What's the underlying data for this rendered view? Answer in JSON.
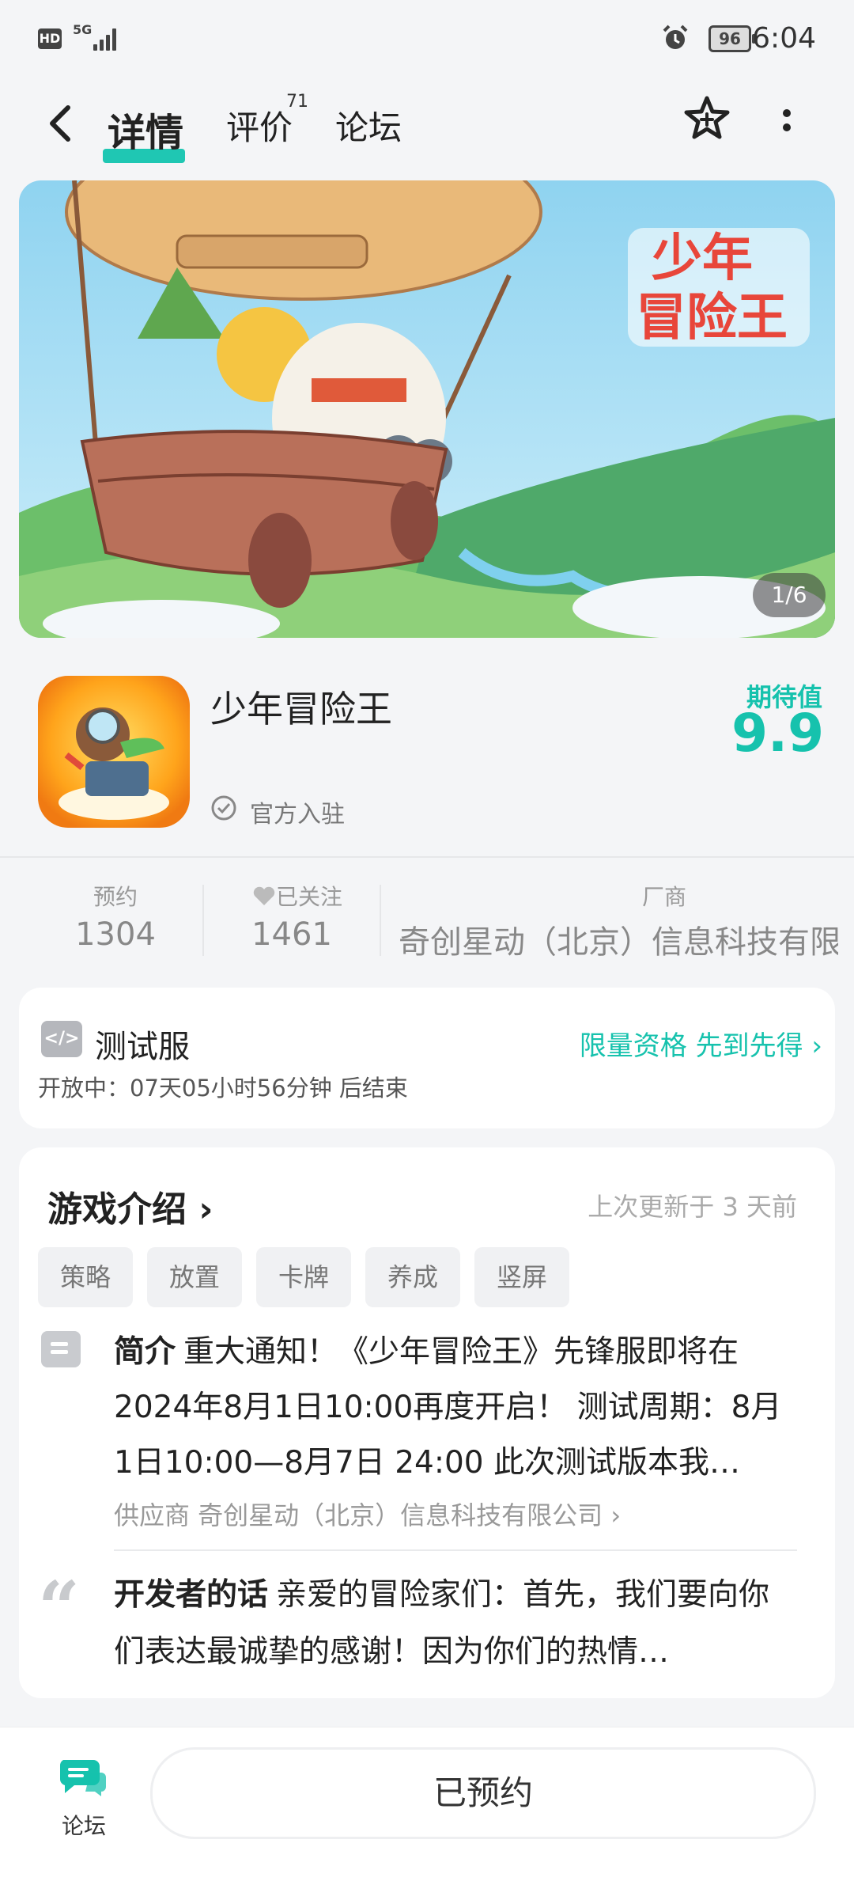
{
  "status_bar": {
    "hd": "HD",
    "network": "5G",
    "battery": "96",
    "time": "6:04"
  },
  "nav": {
    "tab_detail": "详情",
    "tab_review": "评价",
    "review_count": "71",
    "tab_forum": "论坛"
  },
  "banner": {
    "pager": "1/6"
  },
  "app": {
    "name": "少年冒险王",
    "official": "官方入驻",
    "expect_label": "期待值",
    "expect_score": "9.9"
  },
  "stats": [
    {
      "label": "预约",
      "value": "1304"
    },
    {
      "label": "已关注",
      "value": "1461"
    },
    {
      "label": "厂商",
      "value": "奇创星动（北京）信息科技有限"
    }
  ],
  "test": {
    "title": "测试服",
    "cta": "限量资格 先到先得",
    "subtitle": "开放中：07天05小时56分钟 后结束"
  },
  "intro": {
    "title": "游戏介绍",
    "updated": "上次更新于 3 天前",
    "tags": [
      "策略",
      "放置",
      "卡牌",
      "养成",
      "竖屏"
    ],
    "summary_label": "简介",
    "summary": "重大通知！《少年冒险王》先锋服即将在2024年8月1日10:00再度开启！ 测试周期：8月1日10:00—8月7日 24:00 此次测试版本我…",
    "supplier": "供应商 奇创星动（北京）信息科技有限公司",
    "dev_label": "开发者的话",
    "dev_text": "亲爱的冒险家们：首先，我们要向你们表达最诚挚的感谢！因为你们的热情…"
  },
  "bottom": {
    "forum_label": "论坛",
    "reserved_label": "已预约"
  },
  "colors": {
    "accent": "#16c2ad"
  }
}
